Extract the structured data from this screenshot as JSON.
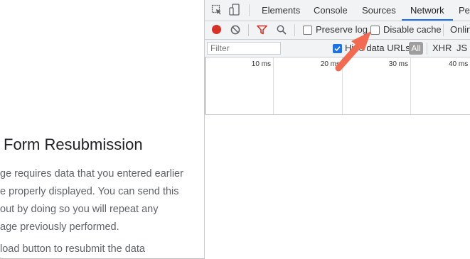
{
  "page": {
    "heading": "Form Resubmission",
    "paragraph_lines": [
      "ge requires data that you entered earlier",
      "e properly displayed. You can send this",
      "out by doing so you will repeat any",
      "age previously performed.",
      "load button to resubmit the data"
    ]
  },
  "devtools": {
    "tabs": [
      "Elements",
      "Console",
      "Sources",
      "Network",
      "Pe"
    ],
    "active_tab": "Network",
    "toolbar": {
      "preserve_log_label": "Preserve log",
      "preserve_log_checked": false,
      "disable_cache_label": "Disable cache",
      "disable_cache_checked": false,
      "throttle_label": "Onlin"
    },
    "filterbar": {
      "filter_placeholder": "Filter",
      "hide_data_urls_label": "Hide data URLs",
      "hide_data_urls_checked": true,
      "type_filters": [
        "All",
        "XHR",
        "JS"
      ]
    },
    "timeline": {
      "ticks": [
        "10 ms",
        "20 ms",
        "30 ms",
        "40 ms"
      ]
    }
  },
  "colors": {
    "record": "#d93025",
    "filter_funnel": "#d93025",
    "checkbox_checked": "#1a73e8",
    "active_tab_underline": "#1a73e8",
    "annotation_arrow": "#f26b50"
  },
  "icons": [
    "inspect-element-icon",
    "device-toolbar-icon",
    "record-icon",
    "clear-icon",
    "filter-icon",
    "search-icon"
  ]
}
